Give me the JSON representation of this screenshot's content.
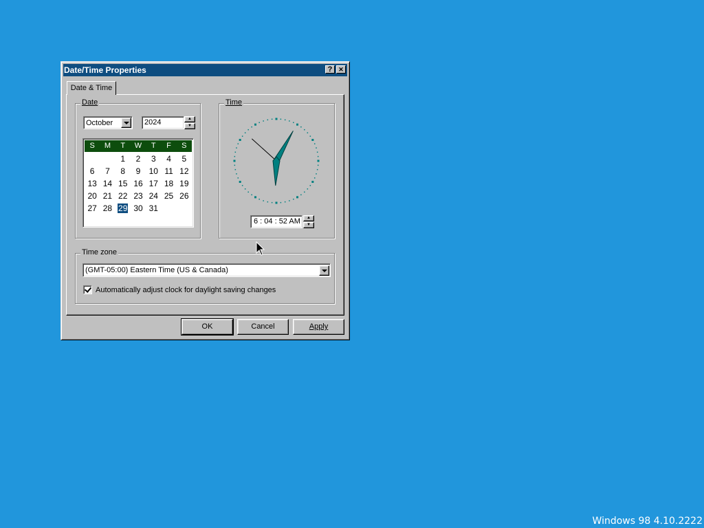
{
  "window": {
    "title": "Date/Time Properties",
    "help_button": "?",
    "close_button": "✕"
  },
  "tabs": [
    {
      "label": "Date & Time",
      "selected": true
    }
  ],
  "date": {
    "group_label": "Date",
    "month": "October",
    "year": "2024",
    "weekdays": [
      "S",
      "M",
      "T",
      "W",
      "T",
      "F",
      "S"
    ],
    "leading_blanks": 2,
    "days": [
      "1",
      "2",
      "3",
      "4",
      "5",
      "6",
      "7",
      "8",
      "9",
      "10",
      "11",
      "12",
      "13",
      "14",
      "15",
      "16",
      "17",
      "18",
      "19",
      "20",
      "21",
      "22",
      "23",
      "24",
      "25",
      "26",
      "27",
      "28",
      "29",
      "30",
      "31"
    ],
    "selected_day": "29",
    "header_color": "#0d4d0d",
    "selection_color": "#0e4d80"
  },
  "time": {
    "group_label": "Time",
    "value": "6 : 04 : 52 AM",
    "clock": {
      "hour": 6,
      "minute": 4,
      "second": 52,
      "hand_color": "#008080"
    }
  },
  "timezone": {
    "group_label": "Time zone",
    "selected": "(GMT-05:00) Eastern Time (US & Canada)",
    "dst_label": "Automatically adjust clock for daylight saving changes",
    "dst_checked": true
  },
  "buttons": {
    "ok": "OK",
    "cancel": "Cancel",
    "apply": "Apply"
  },
  "desktop": {
    "background": "#2196dc",
    "version_text": "Windows 98 4.10.2222"
  }
}
